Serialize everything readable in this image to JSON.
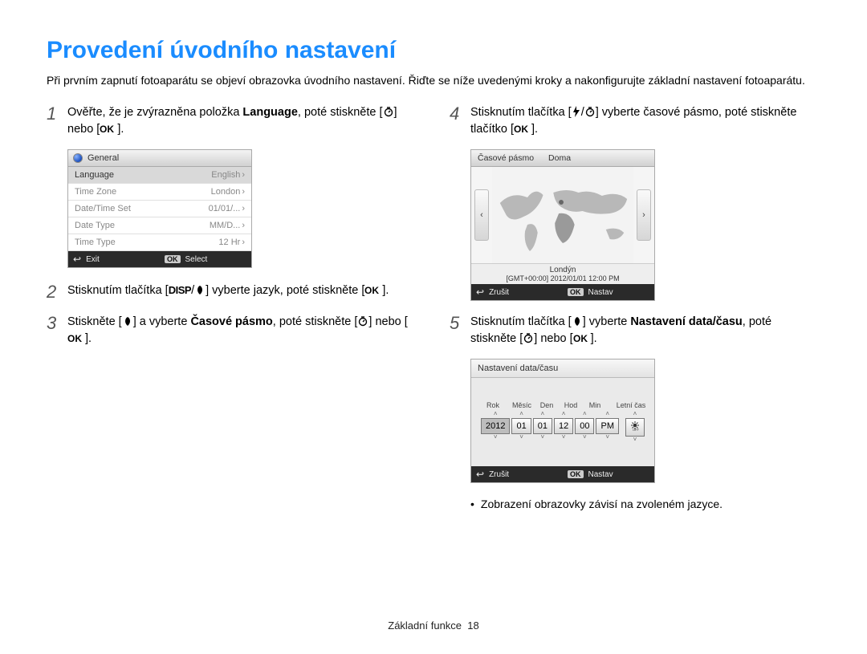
{
  "title": "Provedení úvodního nastavení",
  "intro": "Při prvním zapnutí fotoaparátu se objeví obrazovka úvodního nastavení. Řiďte se níže uvedenými kroky a nakonfigurujte základní nastavení fotoaparátu.",
  "steps": {
    "s1a": "Ověřte, že je zvýrazněna položka ",
    "s1b": "Language",
    "s1c": ", poté stiskněte [",
    "s1d": "] nebo [",
    "s1e": "].",
    "s2a": "Stisknutím tlačítka [",
    "s2b": "] vyberte jazyk, poté stiskněte [",
    "s2c": "].",
    "s3a": "Stiskněte [",
    "s3b": "] a vyberte ",
    "s3c": "Časové pásmo",
    "s3d": ", poté stiskněte [",
    "s3e": "] nebo [",
    "s3f": "].",
    "s4a": "Stisknutím tlačítka [",
    "s4b": "] vyberte časové pásmo, poté stiskněte tlačítko [",
    "s4c": "].",
    "s5a": "Stisknutím tlačítka [",
    "s5b": "] vyberte ",
    "s5c": "Nastavení data/času",
    "s5d": ", poté stiskněte [",
    "s5e": "] nebo [",
    "s5f": "]."
  },
  "lcd_general": {
    "header": "General",
    "rows": [
      {
        "label": "Language",
        "value": "English",
        "sel": true
      },
      {
        "label": "Time Zone",
        "value": "London"
      },
      {
        "label": "Date/Time Set",
        "value": "01/01/..."
      },
      {
        "label": "Date Type",
        "value": "MM/D..."
      },
      {
        "label": "Time Type",
        "value": "12 Hr"
      }
    ],
    "exit": "Exit",
    "select": "Select"
  },
  "lcd_map": {
    "title": "Časové pásmo",
    "home": "Doma",
    "city": "Londýn",
    "gmt": "[GMT+00:00] 2012/01/01 12:00 PM",
    "cancel": "Zrušit",
    "set": "Nastav"
  },
  "lcd_dt": {
    "title": "Nastavení data/času",
    "labels": [
      "Rok",
      "Měsíc",
      "Den",
      "Hod",
      "Min",
      "",
      "Letní čas"
    ],
    "cells": [
      "2012",
      "01",
      "01",
      "12",
      "00",
      "PM"
    ],
    "cancel": "Zrušit",
    "set": "Nastav"
  },
  "note": "Zobrazení obrazovky závisí na zvoleném jazyce.",
  "footer_a": "Základní funkce",
  "footer_b": "18",
  "glyphs": {
    "disp": "DISP",
    "slash": "/",
    "bracket_open": "[",
    "bracket_close": "]"
  }
}
